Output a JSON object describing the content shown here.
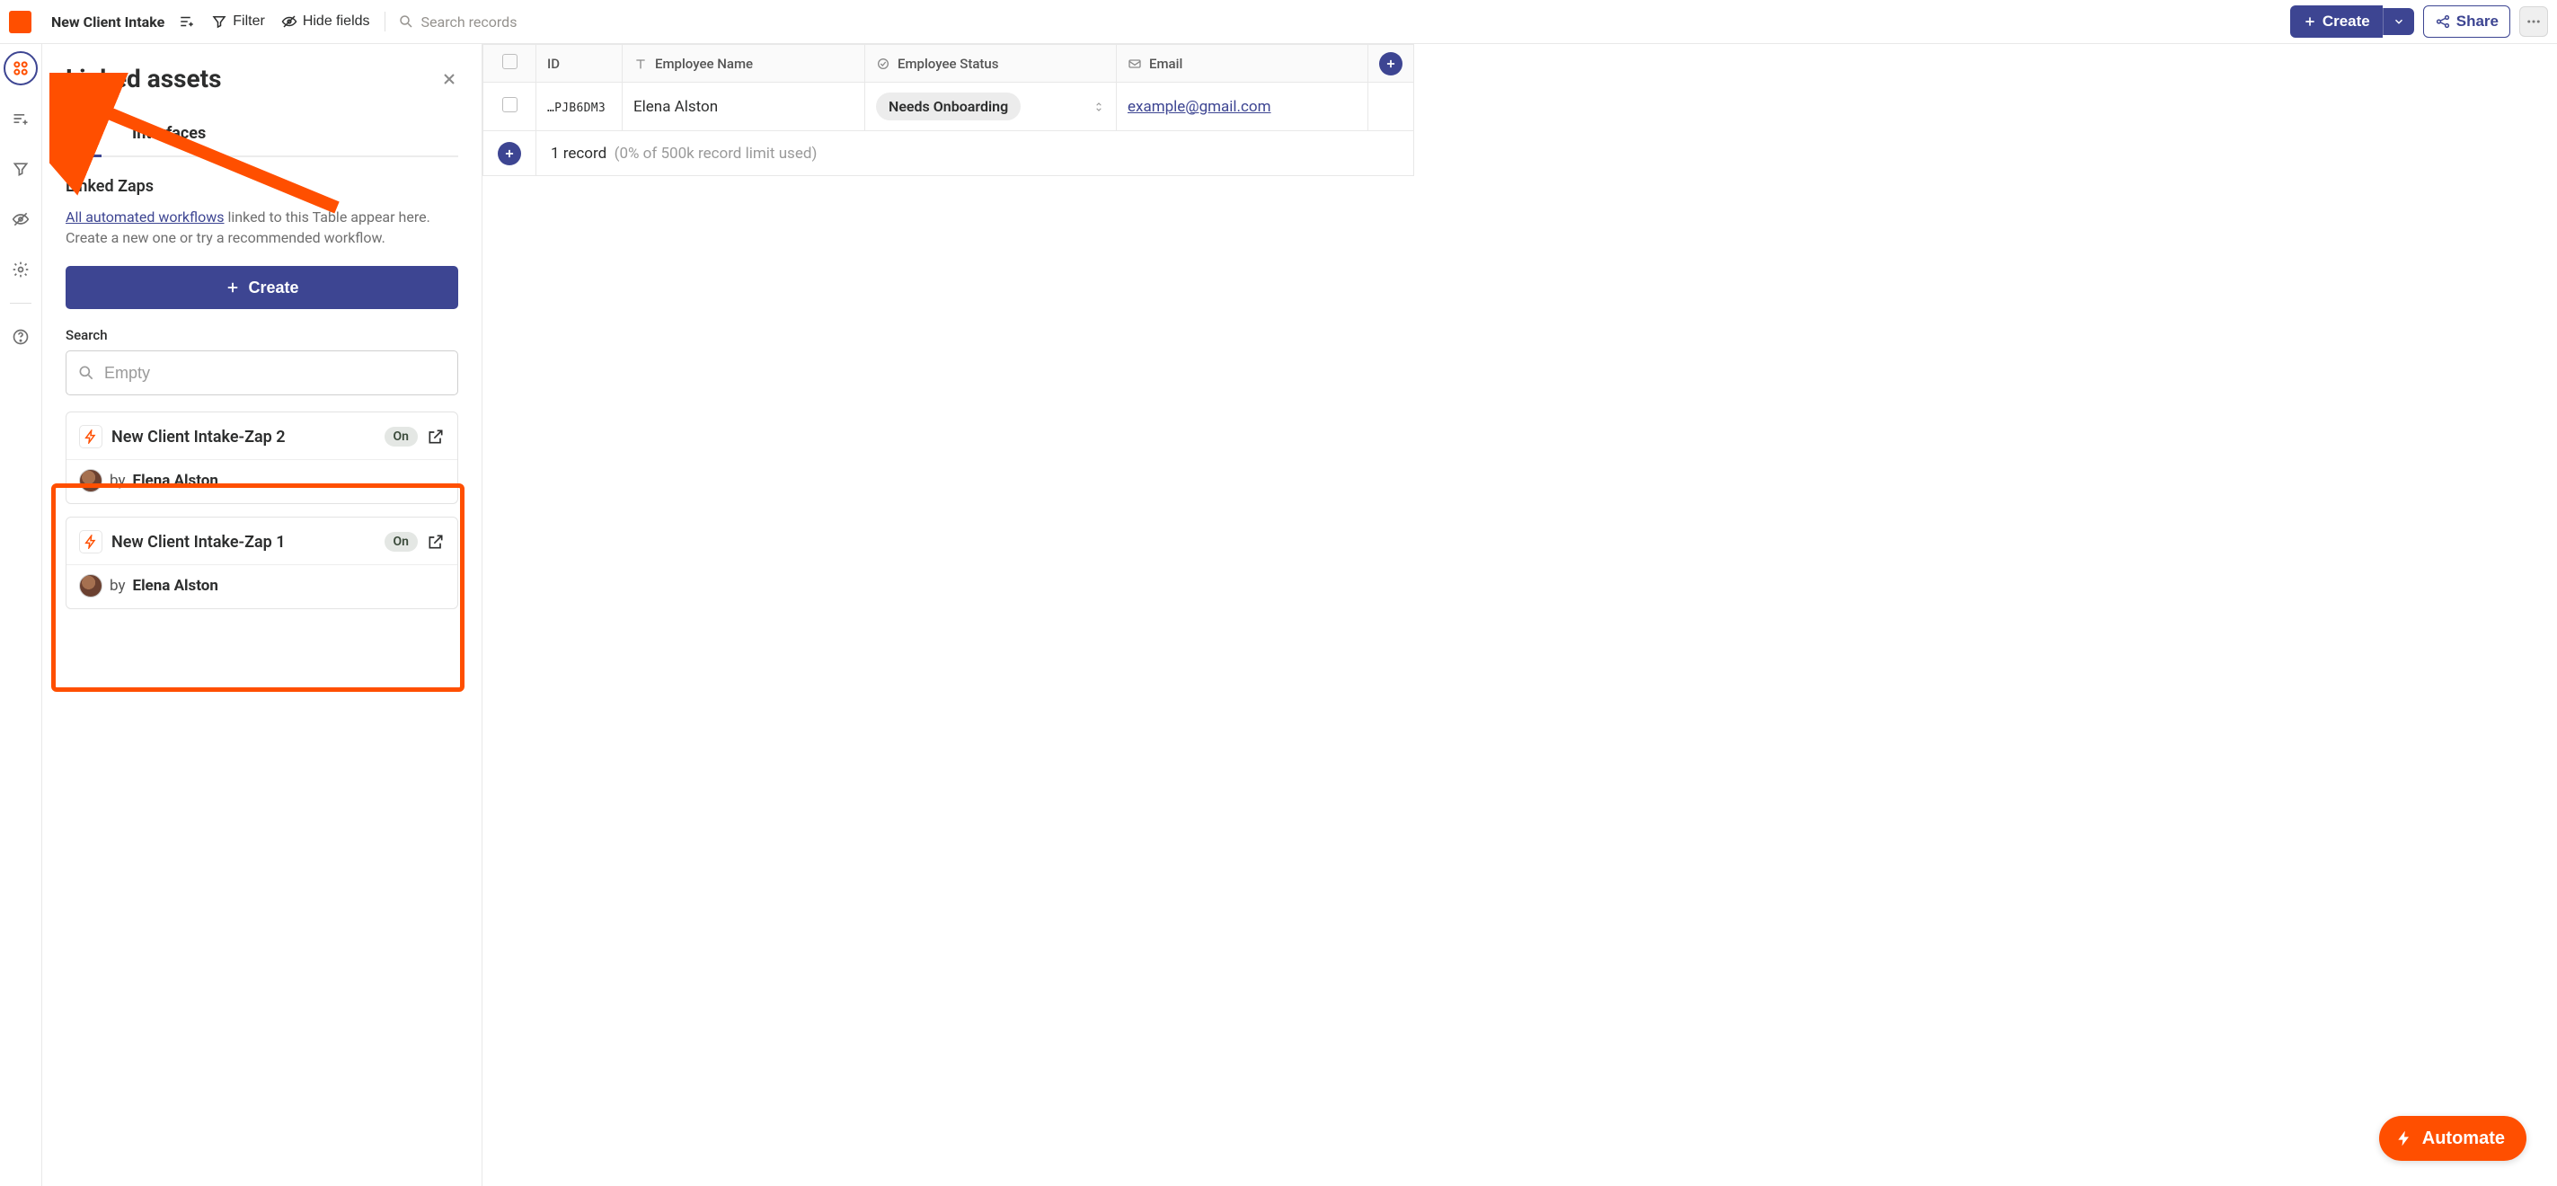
{
  "topbar": {
    "table_name": "New Client Intake",
    "filter_label": "Filter",
    "hide_fields_label": "Hide fields",
    "search_placeholder": "Search records",
    "create_label": "Create",
    "share_label": "Share"
  },
  "panel": {
    "title": "Linked assets",
    "tabs": {
      "zaps": "Zaps",
      "interfaces": "Interfaces"
    },
    "section_title": "Linked Zaps",
    "desc_link": "All automated workflows",
    "desc_rest": " linked to this Table appear here. Create a new one or try a recommended workflow.",
    "create_label": "Create",
    "search_label": "Search",
    "search_placeholder": "Empty",
    "zaps": [
      {
        "name": "New Client Intake-Zap 2",
        "status": "On",
        "by_prefix": "by ",
        "author": "Elena Alston"
      },
      {
        "name": "New Client Intake-Zap 1",
        "status": "On",
        "by_prefix": "by ",
        "author": "Elena Alston"
      }
    ]
  },
  "table": {
    "columns": {
      "id": "ID",
      "employee_name": "Employee Name",
      "employee_status": "Employee Status",
      "email": "Email"
    },
    "rows": [
      {
        "id": "…PJB6DM3",
        "employee_name": "Elena Alston",
        "employee_status": "Needs Onboarding",
        "email": "example@gmail.com"
      }
    ],
    "footer": {
      "count": "1 record",
      "limit": "(0% of 500k record limit used)"
    }
  },
  "fab": {
    "label": "Automate"
  }
}
